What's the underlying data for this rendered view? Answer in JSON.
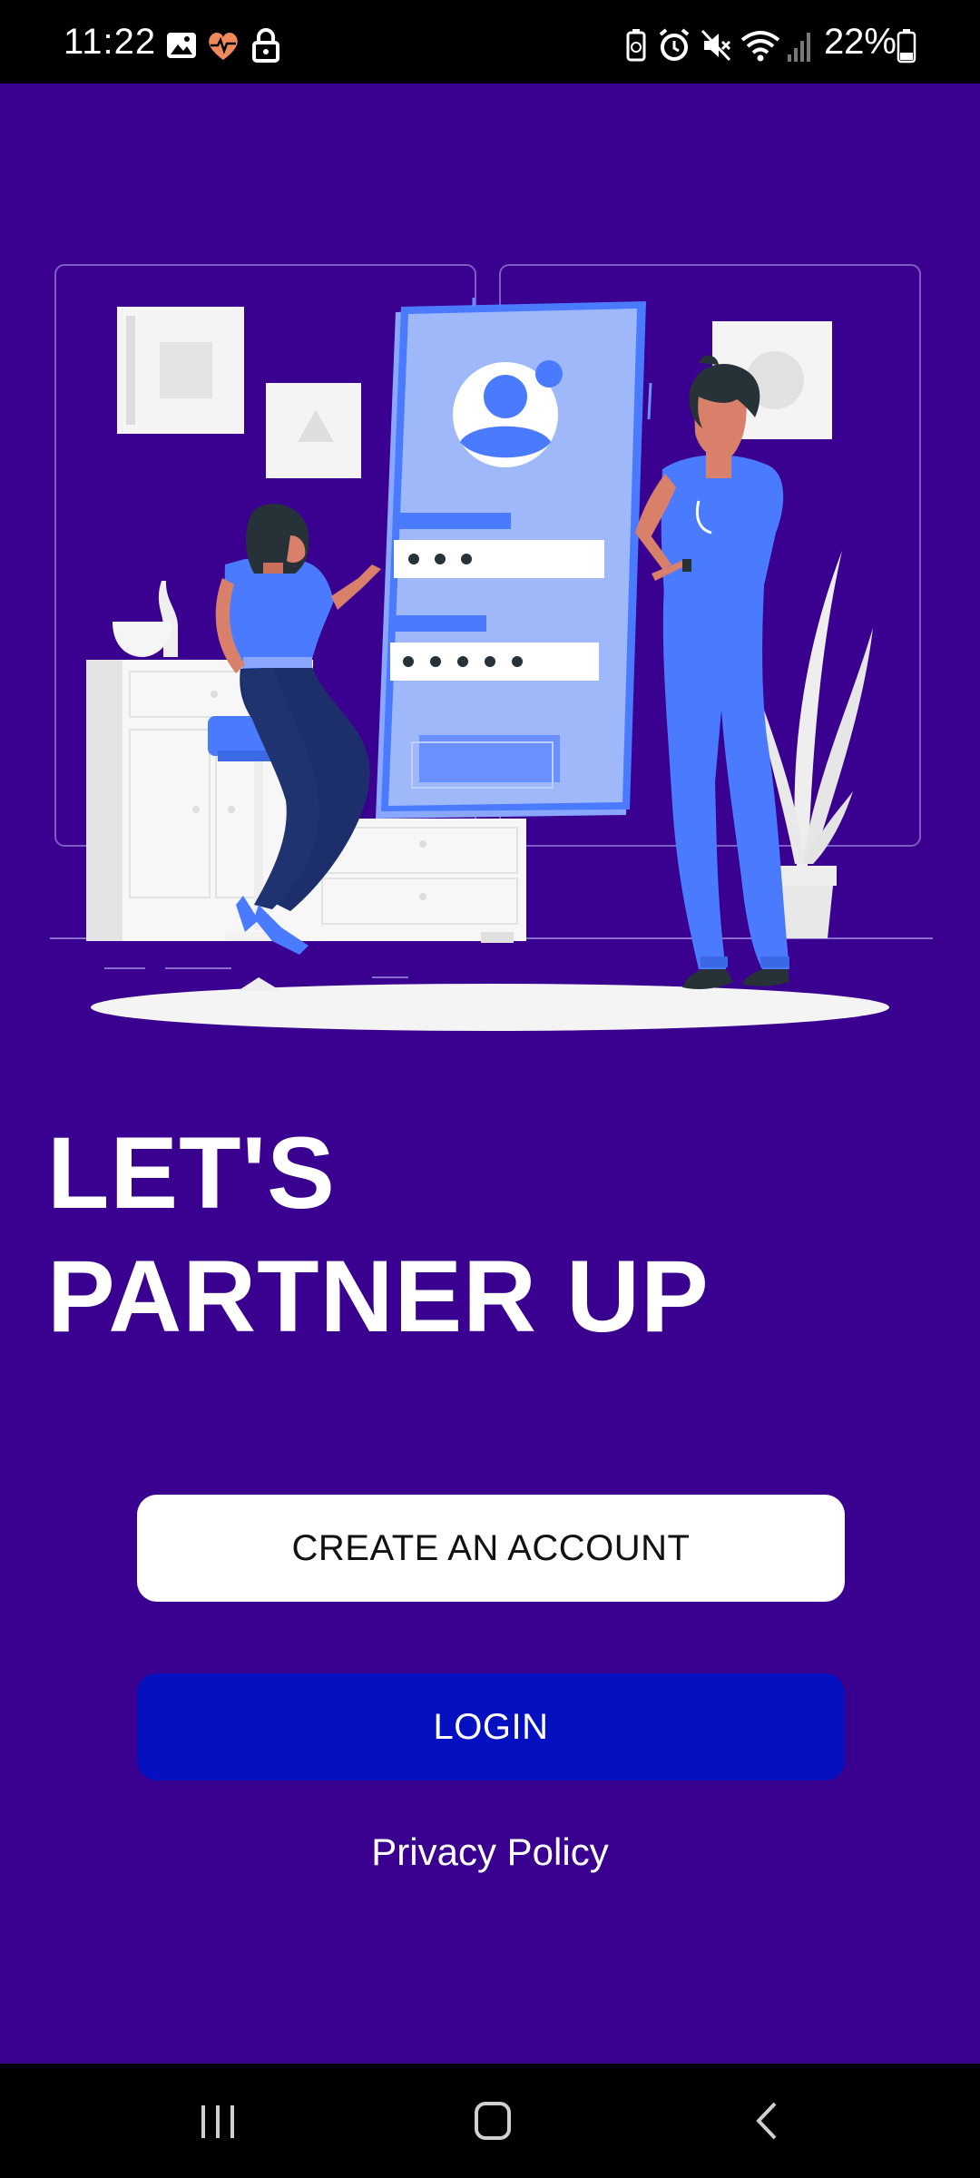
{
  "status_bar": {
    "time": "11:22",
    "battery": "22%",
    "left_icons": [
      "image-icon",
      "heart-monitor-icon",
      "lock-icon"
    ],
    "right_icons": [
      "battery-saver-icon",
      "alarm-icon",
      "mute-icon",
      "wifi-icon",
      "signal-icon",
      "battery-icon"
    ]
  },
  "hero": {
    "headline_line1": "LET'S",
    "headline_line2": "PARTNER UP"
  },
  "actions": {
    "create_account": "CREATE AN ACCOUNT",
    "login": "LOGIN",
    "privacy": "Privacy Policy"
  },
  "nav_bar": {
    "items": [
      "recents-icon",
      "home-icon",
      "back-icon"
    ]
  },
  "colors": {
    "background": "#3a0090",
    "login_button": "#0510c1",
    "accent_blue": "#4a7bff"
  }
}
